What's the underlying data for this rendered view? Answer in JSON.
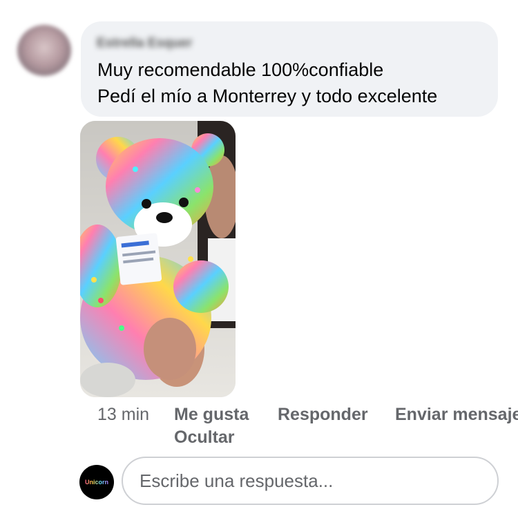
{
  "comment": {
    "author": "Estrella Esquer",
    "text_line1": "Muy recomendable 100%confiable",
    "text_line2": "Pedí el mío a Monterrey y todo excelente",
    "attachment": "photo"
  },
  "actions": {
    "time": "13 min",
    "like": "Me gusta",
    "reply": "Responder",
    "send_message": "Enviar mensaje",
    "hide": "Ocultar"
  },
  "reply_box": {
    "placeholder": "Escribe una respuesta...",
    "avatar_label": "Unicorn"
  },
  "icons": {
    "commenter_avatar": "avatar-icon",
    "user_avatar": "avatar-icon"
  }
}
